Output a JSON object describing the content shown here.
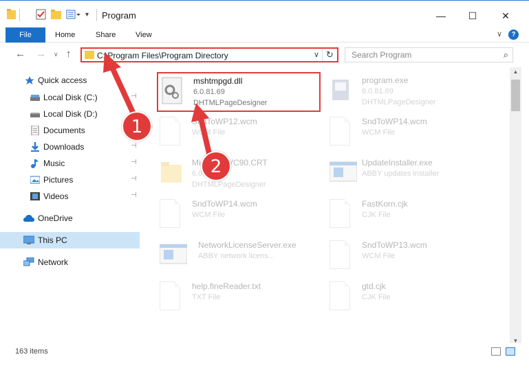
{
  "window": {
    "title": "Program",
    "min_glyph": "—",
    "max_glyph": "☐",
    "close_glyph": "✕"
  },
  "ribbon": {
    "tabs": [
      "File",
      "Home",
      "Share",
      "View"
    ],
    "help_glyph": "?",
    "collapse_glyph": "∨"
  },
  "nav": {
    "back_glyph": "←",
    "forward_glyph": "→",
    "recent_glyph": "∨",
    "up_glyph": "↑",
    "address": "C:\\Program Files\\Program Directory",
    "address_dropdown_glyph": "∨",
    "refresh_glyph": "↻",
    "search_placeholder": "Search Program",
    "search_glyph": "⌕"
  },
  "sidebar": {
    "items": [
      {
        "label": "Quick access"
      },
      {
        "label": "Local Disk (C:)"
      },
      {
        "label": "Local Disk (D:)"
      },
      {
        "label": "Documents"
      },
      {
        "label": "Downloads"
      },
      {
        "label": "Music"
      },
      {
        "label": "Pictures"
      },
      {
        "label": "Videos"
      },
      {
        "label": "OneDrive"
      },
      {
        "label": "This PC"
      },
      {
        "label": "Network"
      }
    ],
    "pin_glyph": "📌"
  },
  "files": [
    {
      "name": "mshtmpgd.dll",
      "sub1": "6.0.81.69",
      "sub2": "DHTMLPageDesigner"
    },
    {
      "name": "program.exe",
      "sub1": "6.0.81.69",
      "sub2": "DHTMLPageDesigner"
    },
    {
      "name": "SndToWP12.wcm",
      "sub1": "WCM File",
      "sub2": ""
    },
    {
      "name": "SndToWP14.wcm",
      "sub1": "WCM File",
      "sub2": ""
    },
    {
      "name": "Microsoft.VC90.CRT",
      "sub1": "6.0.81.69",
      "sub2": "DHTMLPageDesigner"
    },
    {
      "name": "UpdateInstaller.exe",
      "sub1": "ABBY updates installer",
      "sub2": ""
    },
    {
      "name": "SndToWP14.wcm",
      "sub1": "WCM File",
      "sub2": ""
    },
    {
      "name": "FastKorn.cjk",
      "sub1": "CJK File",
      "sub2": ""
    },
    {
      "name": "NetworkLicenseServer.exe",
      "sub1": "ABBY network licens...",
      "sub2": ""
    },
    {
      "name": "SndToWP13.wcm",
      "sub1": "WCM File",
      "sub2": ""
    },
    {
      "name": "help.fineReader.txt",
      "sub1": "TXT File",
      "sub2": ""
    },
    {
      "name": "gtd.cjk",
      "sub1": "CJK File",
      "sub2": ""
    }
  ],
  "status": {
    "count": "163 items"
  },
  "callouts": [
    "1",
    "2"
  ],
  "colors": {
    "accent": "#1a6fc8",
    "highlight": "#e23a3a",
    "selection": "#cce4f7"
  }
}
